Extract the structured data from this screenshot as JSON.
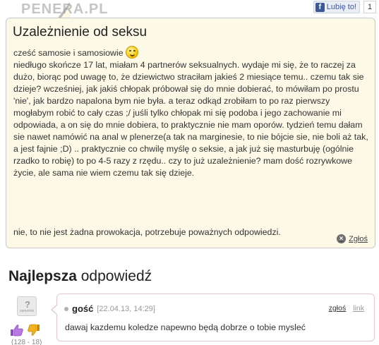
{
  "like_widget": {
    "icon": "facebook-icon",
    "label": "Lubię to!",
    "count": "1"
  },
  "question": {
    "watermark": "PENERA.PL",
    "title": "Uzależnienie od seksu",
    "greeting": "cześć samosie i samosiowie",
    "greeting_icon": "wink-smiley-icon",
    "body": "niedługo skończe 17 lat, miałam 4 partnerów seksualnych. wydaje mi się, że to raczej za dużo, biorąc pod uwagę to, że dziewictwo straciłam jakieś 2 miesiące temu.. czemu tak sie dzieje? wcześniej, jak jakiś chłopak próbował się do mnie dobierać, to mówiłam po prostu 'nie', jak bardzo napalona bym nie była. a teraz odkąd zrobiłam to po raz pierwszy mogłabym robić to cały czas ;/ juśli tylko chłopak mi się podoba i jego zachowanie mi odpowiada, a on się do mnie dobiera, to praktycznie nie mam oporów. tydzień temu dałam sie nawet namówić na anal w plenerze(a tak na marginesie, to nie bójcie sie, nie boli aż tak, a jest fajnie ;D) .. praktycznie co chwilę myślę o seksie, a jak już się masturbuję (ogólnie rzadko to robię) to po 4-5 razy z rzędu.. czy to już uzależnienie? mam dość rozrywkowe życie, ale sama nie wiem czemu tak się dzieje.",
    "footer": "nie, to nie jest żadna prowokacja, potrzebuje poważnych odpowiedzi.",
    "report_label": "Zgłoś",
    "report_icon": "close-circle-icon"
  },
  "best_answer": {
    "heading_bold": "Najlepsza",
    "heading_rest": " odpowiedź",
    "avatar_caption": "samotnik",
    "avatar_icon": "anonymous-avatar-icon",
    "votes": "(128 - 18)",
    "vote_up_icon": "thumbs-up-icon",
    "vote_down_icon": "thumbs-down-icon",
    "user": "gość",
    "date": "[22.04.13, 14:29]",
    "report_link": "zgłoś",
    "permalink": "link",
    "text": "dawaj kazdemu koledze napewno będą dobrze o tobie mysleć"
  },
  "colors": {
    "question_bg": "#fdf9e7",
    "facebook_blue": "#3b5998",
    "answer_border": "#e2c9c9",
    "thumb_up": "#a86ad0",
    "thumb_down": "#e0a000"
  }
}
